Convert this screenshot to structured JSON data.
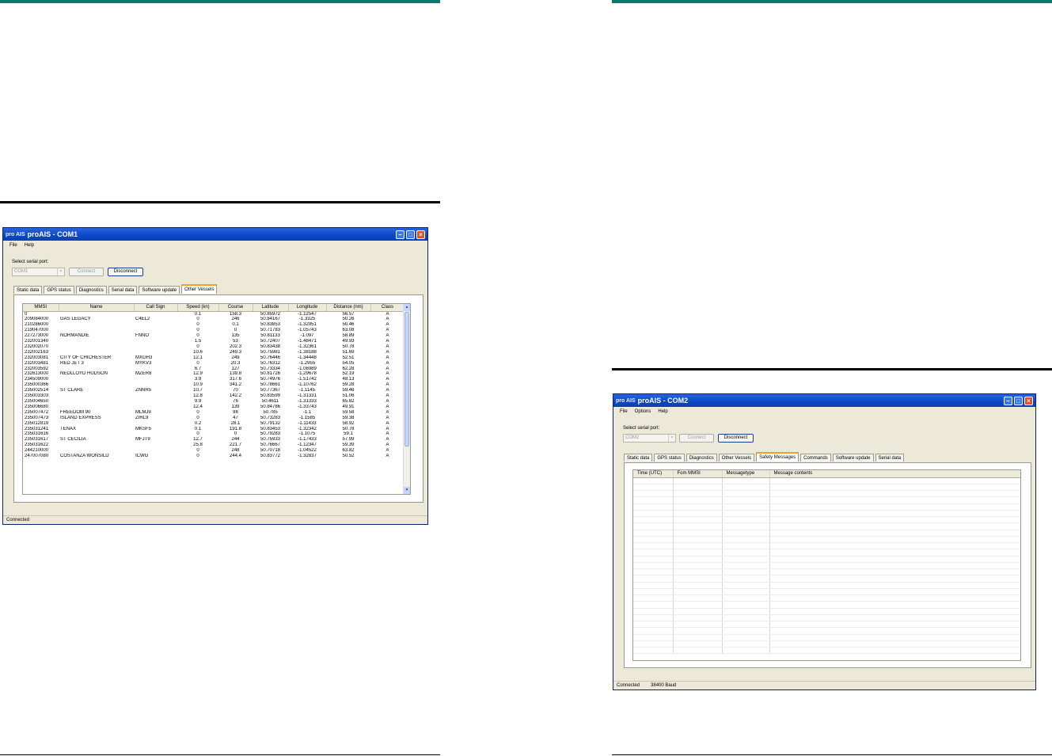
{
  "left_window": {
    "title": "proAIS - COM1",
    "logo_text": "pro AIS",
    "menu": [
      "File",
      "Help"
    ],
    "serial_port_label": "Select serial port:",
    "port_value": "COM1",
    "connect_label": "Connect",
    "disconnect_label": "Disconnect",
    "tabs": [
      "Static data",
      "GPS status",
      "Diagnostics",
      "Serial data",
      "Software update",
      "Other Vessels"
    ],
    "selected_tab": "Other Vessels",
    "columns": [
      "MMSI",
      "Name",
      "Call Sign",
      "Speed (kn)",
      "Course",
      "Latitude",
      "Longitude",
      "Distance (nm)",
      "Class"
    ],
    "rows": [
      [
        "0",
        "",
        "",
        "0.1",
        "158.3",
        "50.85972",
        "-1.12547",
        "56.57",
        "A"
      ],
      [
        "209084000",
        "GAS LEGACY",
        "C4EL2",
        "0",
        "246",
        "50.84167",
        "-1.3325",
        "50.26",
        "A"
      ],
      [
        "210286000",
        "",
        "",
        "0",
        "0.1",
        "50.83853",
        "-1.32951",
        "50.46",
        "A"
      ],
      [
        "219047000",
        "",
        "",
        "0",
        "0",
        "50.71783",
        "-1.05743",
        "63.08",
        "A"
      ],
      [
        "227273000",
        "NORMANDIE",
        "FNNO",
        "0",
        "135",
        "50.81133",
        "-1.097",
        "58.89",
        "A"
      ],
      [
        "232001340",
        "",
        "",
        "1.5",
        "53",
        "50.72407",
        "-1.48471",
        "49.93",
        "A"
      ],
      [
        "232002070",
        "",
        "",
        "0",
        "202.3",
        "50.83438",
        "-1.32361",
        "50.78",
        "A"
      ],
      [
        "232002163",
        "",
        "",
        "10.6",
        "249.3",
        "50.75981",
        "-1.38188",
        "51.69",
        "A"
      ],
      [
        "232003081",
        "CITY OF CHICHESTER",
        "MXGH3",
        "12.1",
        "249",
        "50.76446",
        "-1.34448",
        "52.51",
        "A"
      ],
      [
        "232003481",
        "RED JET 3",
        "MYKV3",
        "0",
        "20.3",
        "50.76312",
        "-1.2955",
        "54.05",
        "A"
      ],
      [
        "232003592",
        "",
        "",
        "6.7",
        "127",
        "50.73334",
        "-1.06989",
        "62.28",
        "A"
      ],
      [
        "232613000",
        "NEDLLOYD HUDSON",
        "MZER8",
        "12.9",
        "139.8",
        "50.81726",
        "-1.29678",
        "52.19",
        "A"
      ],
      [
        "234509000",
        "",
        "",
        "3.9",
        "317.6",
        "50.74976",
        "-1.51742",
        "48.13",
        "A"
      ],
      [
        "235000366",
        "",
        "",
        "10.9",
        "341.2",
        "50.78661",
        "-1.10762",
        "59.28",
        "A"
      ],
      [
        "235002514",
        "ST CLARE",
        "ZNNR5",
        "10.7",
        "70",
        "50.77367",
        "-1.1145",
        "59.46",
        "A"
      ],
      [
        "235003303",
        "",
        "",
        "12.8",
        "142.2",
        "50.83599",
        "-1.31331",
        "51.06",
        "A"
      ],
      [
        "235004650",
        "",
        "",
        "9.9",
        "76",
        "50.4611",
        "-1.31333",
        "65.82",
        "A"
      ],
      [
        "235006680",
        "",
        "",
        "12.4",
        "139",
        "50.84786",
        "-1.33743",
        "49.91",
        "A"
      ],
      [
        "235007472",
        "FREEDOM 90",
        "MLMJ9",
        "0",
        "98",
        "50.785",
        "-1.1",
        "59.58",
        "A"
      ],
      [
        "235007473",
        "ISLAND EXPRESS",
        "ZIRL9",
        "0",
        "47",
        "50.73283",
        "-1.1585",
        "59.38",
        "A"
      ],
      [
        "235012819",
        "",
        "",
        "0.2",
        "28.1",
        "50.79132",
        "-1.11433",
        "58.92",
        "A"
      ],
      [
        "235031241",
        "TENAX",
        "MKSF5",
        "0.1",
        "191.8",
        "50.83453",
        "-1.32342",
        "50.78",
        "A"
      ],
      [
        "235031616",
        "",
        "",
        "0",
        "0",
        "50.79283",
        "-1.1075",
        "59.1",
        "A"
      ],
      [
        "235031617",
        "ST CECILIA",
        "MFJT9",
        "12.7",
        "244",
        "50.75933",
        "-1.17433",
        "57.99",
        "A"
      ],
      [
        "235031622",
        "",
        "",
        "25.8",
        "221.7",
        "50.76667",
        "-1.12347",
        "59.39",
        "A"
      ],
      [
        "244210000",
        "",
        "",
        "0",
        "248",
        "50.70718",
        "-1.04522",
        "63.82",
        "A"
      ],
      [
        "247007080",
        "COSTANZA WONSILD",
        "ICWG",
        "0",
        "244.4",
        "50.83772",
        "-1.32837",
        "50.52",
        "A"
      ]
    ],
    "status": "Connected"
  },
  "right_window": {
    "title": "proAIS - COM2",
    "logo_text": "pro AIS",
    "menu": [
      "File",
      "Options",
      "Help"
    ],
    "serial_port_label": "Select serial port:",
    "port_value": "COM2",
    "connect_label": "Connect",
    "disconnect_label": "Disconnect",
    "tabs": [
      "Static data",
      "GPS status",
      "Diagnostics",
      "Other Vessels",
      "Safety Messages",
      "Commands",
      "Software update",
      "Serial data"
    ],
    "selected_tab": "Safety Messages",
    "columns": [
      "Time (UTC)",
      "Fom MMSI",
      "Messagetype",
      "Message contents"
    ],
    "status": "Connected",
    "baud": "38400 Baud"
  },
  "colors": {
    "page_rule": "#000000",
    "accent_rule": "#0b7a6e",
    "title_bar": "#0a48c8",
    "window_bg": "#ece9d8"
  }
}
